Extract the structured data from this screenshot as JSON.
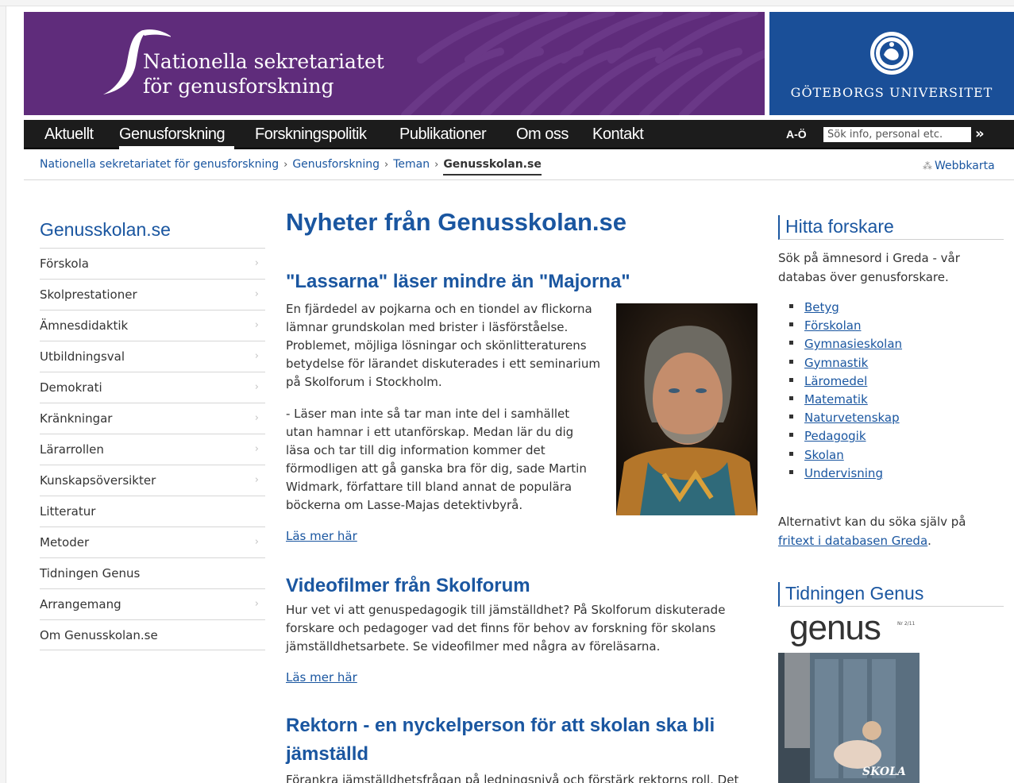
{
  "header": {
    "org_line1": "Nationella sekretariatet",
    "org_line2": "för genusforskning",
    "university": "GÖTEBORGS UNIVERSITET"
  },
  "nav": {
    "items": [
      "Aktuellt",
      "Genusforskning",
      "Forskningspolitik",
      "Publikationer",
      "Om oss",
      "Kontakt"
    ],
    "active": "Genusforskning",
    "az_label": "A-Ö",
    "search_placeholder": "Sök info, personal etc.",
    "search_go": "»"
  },
  "breadcrumb": {
    "items": [
      "Nationella sekretariatet för genusforskning",
      "Genusforskning",
      "Teman"
    ],
    "separator": "›",
    "current": "Genusskolan.se",
    "sitemap": "Webbkarta"
  },
  "sidebar": {
    "title": "Genusskolan.se",
    "items": [
      {
        "label": "Förskola",
        "has_children": true
      },
      {
        "label": "Skolprestationer",
        "has_children": true
      },
      {
        "label": "Ämnesdidaktik",
        "has_children": true
      },
      {
        "label": "Utbildningsval",
        "has_children": true
      },
      {
        "label": "Demokrati",
        "has_children": true
      },
      {
        "label": "Kränkningar",
        "has_children": true
      },
      {
        "label": "Lärarrollen",
        "has_children": true
      },
      {
        "label": "Kunskapsöversikter",
        "has_children": true
      },
      {
        "label": "Litteratur",
        "has_children": false
      },
      {
        "label": "Metoder",
        "has_children": true
      },
      {
        "label": "Tidningen Genus",
        "has_children": false
      },
      {
        "label": "Arrangemang",
        "has_children": true
      },
      {
        "label": "Om Genusskolan.se",
        "has_children": false
      }
    ],
    "chevron": "›"
  },
  "main": {
    "title": "Nyheter från Genusskolan.se",
    "articles": [
      {
        "title": "\"Lassarna\" läser mindre än \"Majorna\"",
        "para1": [
          "En fjärdedel av pojkarna och en tiondel av flickorna",
          "lämnar grundskolan med brister i läsförståelse.",
          "Problemet, möjliga lösningar och skönlitteraturens",
          "betydelse för lärandet diskuterades i ett seminarium",
          "på Skolforum i Stockholm."
        ],
        "para2": [
          "- Läser man inte så tar man inte del i samhället",
          "utan hamnar i ett utanförskap. Medan lär du dig",
          "läsa och tar till dig information kommer det",
          "förmodligen att gå ganska bra för dig, sade Martin",
          "Widmark, författare till bland annat de populära",
          "böckerna om Lasse-Majas detektivbyrå."
        ],
        "link": "Läs mer här"
      },
      {
        "title": "Videofilmer från Skolforum",
        "para1": [
          "Hur vet vi att genuspedagogik till jämställdhet? På Skolforum diskuterade",
          "forskare och pedagoger vad det finns för behov av forskning för skolans",
          "jämställdhetsarbete. Se videofilmer med några av föreläsarna."
        ],
        "link": "Läs mer här"
      },
      {
        "title_line1": "Rektorn - en nyckelperson för att skolan ska bli",
        "title_line2": "jämställd",
        "para1": [
          "Förankra jämställdhetsfrågan på ledningsnivå och förstärk rektorns roll. Det"
        ]
      }
    ]
  },
  "right": {
    "find_title": "Hitta forskare",
    "find_text": [
      "Sök på ämnesord i Greda - vår",
      "databas över genusforskare."
    ],
    "topics": [
      "Betyg",
      "Förskolan",
      "Gymnasieskolan",
      "Gymnastik",
      "Läromedel",
      "Matematik",
      "Naturvetenskap",
      "Pedagogik",
      "Skolan",
      "Undervisning"
    ],
    "alt_text": "Alternativt kan du söka själv på",
    "alt_link": "fritext i databasen Greda",
    "alt_end": ".",
    "magazine_title": "Tidningen Genus",
    "cover_logo": "genus",
    "cover_issue": "Nr 2/11",
    "cover_text": "SKOLA"
  },
  "colors": {
    "header_purple": "#5f2c7b",
    "gu_blue": "#1a4f98",
    "nav_black": "#1c1c1c",
    "link_blue": "#1a56a0"
  }
}
